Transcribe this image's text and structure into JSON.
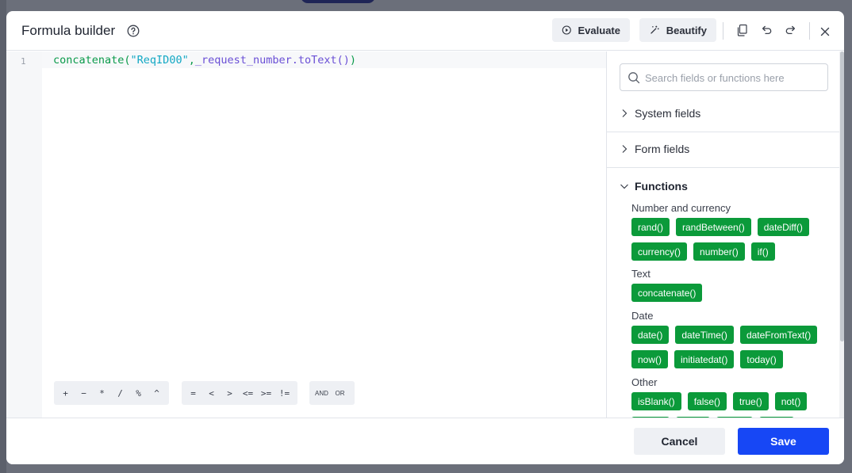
{
  "dialog": {
    "title": "Formula builder",
    "toolbar": {
      "evaluate_label": "Evaluate",
      "beautify_label": "Beautify"
    }
  },
  "editor": {
    "line_number": "1",
    "code": {
      "fn": "concatenate(",
      "str": "\"ReqID00\"",
      "comma": ",",
      "prop": "_request_number.toText()",
      "close": ")"
    },
    "operators": {
      "arithmetic": [
        "+",
        "−",
        "*",
        "/",
        "%",
        "^"
      ],
      "comparison": [
        "=",
        "<",
        ">",
        "<=",
        ">=",
        "!="
      ],
      "logical": [
        "AND",
        "OR"
      ]
    }
  },
  "sidebar": {
    "search_placeholder": "Search fields or functions here",
    "sections": {
      "system_fields": "System fields",
      "form_fields": "Form fields",
      "functions": "Functions"
    },
    "groups": {
      "number": {
        "title": "Number and currency",
        "row1": [
          "rand()",
          "randBetween()",
          "dateDiff()"
        ],
        "row2": [
          "currency()",
          "number()",
          "if()"
        ]
      },
      "text": {
        "title": "Text",
        "row1": [
          "concatenate()"
        ]
      },
      "date": {
        "title": "Date",
        "row1": [
          "date()",
          "dateTime()",
          "dateFromText()"
        ],
        "row2": [
          "now()",
          "initiatedat()",
          "today()"
        ]
      },
      "other": {
        "title": "Other",
        "row1": [
          "isBlank()",
          "false()",
          "true()",
          "not()"
        ]
      }
    }
  },
  "footer": {
    "cancel_label": "Cancel",
    "save_label": "Save"
  },
  "colors": {
    "chip": "#0b9a3a",
    "primary": "#1747f5"
  }
}
